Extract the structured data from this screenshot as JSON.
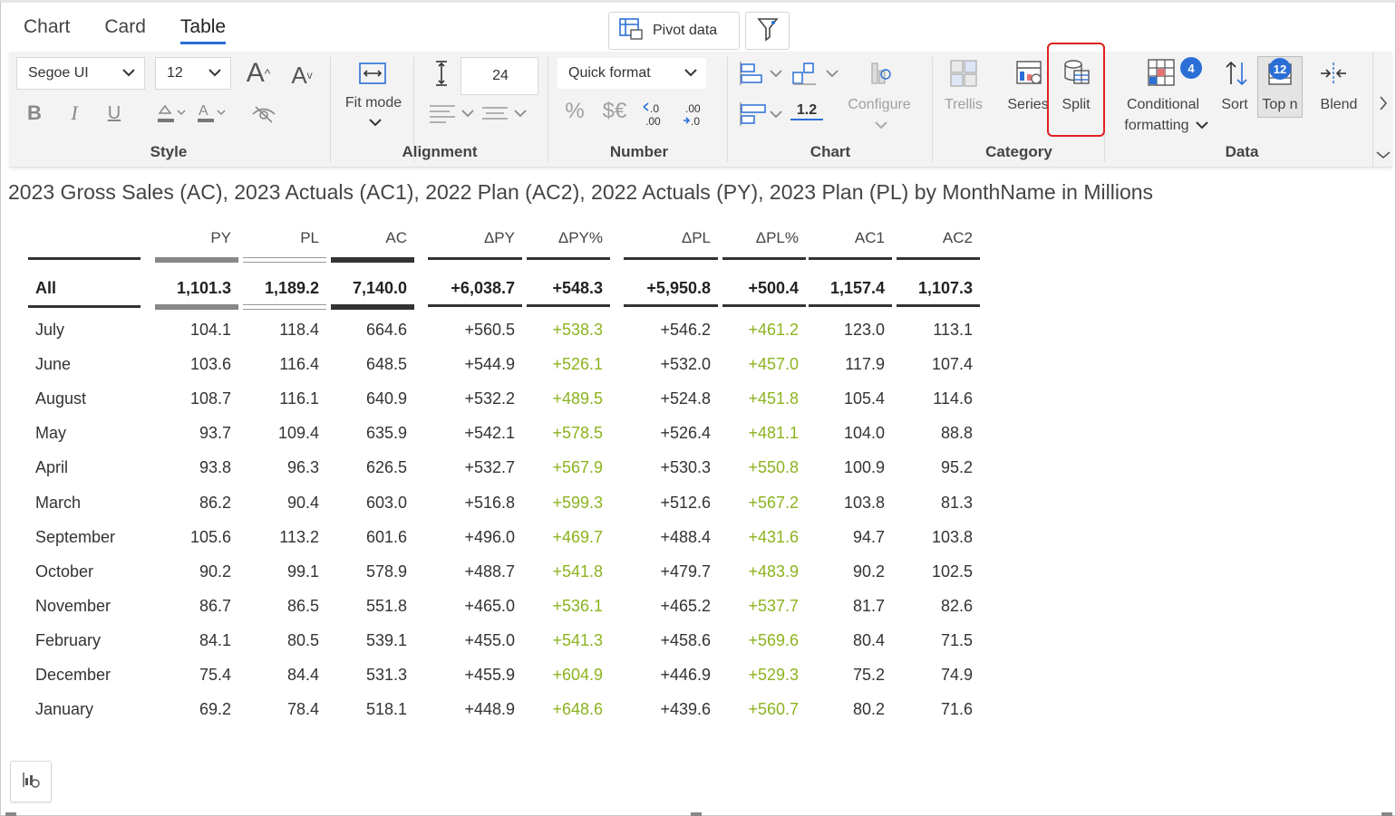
{
  "tabs": [
    {
      "label": "Chart",
      "active": false
    },
    {
      "label": "Card",
      "active": false
    },
    {
      "label": "Table",
      "active": true
    }
  ],
  "top_buttons": {
    "pivot_label": "Pivot data"
  },
  "ribbon": {
    "style": {
      "label": "Style",
      "font_family": "Segoe UI",
      "font_size": "12"
    },
    "alignment": {
      "label": "Alignment",
      "fit_mode": "Fit mode",
      "row_height": "24"
    },
    "number": {
      "label": "Number",
      "quick_format": "Quick format",
      "percent": "%",
      "currency": "$€"
    },
    "chart": {
      "label": "Chart",
      "scale_value": "1.2",
      "configure": "Configure"
    },
    "category": {
      "label": "Category",
      "trellis": "Trellis",
      "series": "Series",
      "split": "Split"
    },
    "data": {
      "label": "Data",
      "conditional_formatting_line1": "Conditional",
      "conditional_formatting_line2": "formatting",
      "conditional_formatting_count": "4",
      "sort": "Sort",
      "top_n": "Top n",
      "top_n_count": "12",
      "blend": "Blend"
    }
  },
  "table": {
    "title": "2023 Gross Sales (AC), 2023 Actuals (AC1), 2022 Plan (AC2), 2022 Actuals (PY), 2023 Plan (PL) by MonthName in Millions",
    "columns": [
      "PY",
      "PL",
      "AC",
      "ΔPY",
      "ΔPY%",
      "ΔPL",
      "ΔPL%",
      "AC1",
      "AC2"
    ],
    "total": {
      "label": "All",
      "values": [
        "1,101.3",
        "1,189.2",
        "7,140.0",
        "+6,038.7",
        "+548.3",
        "+5,950.8",
        "+500.4",
        "1,157.4",
        "1,107.3"
      ]
    },
    "rows": [
      {
        "label": "July",
        "values": [
          "104.1",
          "118.4",
          "664.6",
          "+560.5",
          "+538.3",
          "+546.2",
          "+461.2",
          "123.0",
          "113.1"
        ]
      },
      {
        "label": "June",
        "values": [
          "103.6",
          "116.4",
          "648.5",
          "+544.9",
          "+526.1",
          "+532.0",
          "+457.0",
          "117.9",
          "107.4"
        ]
      },
      {
        "label": "August",
        "values": [
          "108.7",
          "116.1",
          "640.9",
          "+532.2",
          "+489.5",
          "+524.8",
          "+451.8",
          "105.4",
          "114.6"
        ]
      },
      {
        "label": "May",
        "values": [
          "93.7",
          "109.4",
          "635.9",
          "+542.1",
          "+578.5",
          "+526.4",
          "+481.1",
          "104.0",
          "88.8"
        ]
      },
      {
        "label": "April",
        "values": [
          "93.8",
          "96.3",
          "626.5",
          "+532.7",
          "+567.9",
          "+530.3",
          "+550.8",
          "100.9",
          "95.2"
        ]
      },
      {
        "label": "March",
        "values": [
          "86.2",
          "90.4",
          "603.0",
          "+516.8",
          "+599.3",
          "+512.6",
          "+567.2",
          "103.8",
          "81.3"
        ]
      },
      {
        "label": "September",
        "values": [
          "105.6",
          "113.2",
          "601.6",
          "+496.0",
          "+469.7",
          "+488.4",
          "+431.6",
          "94.7",
          "103.8"
        ]
      },
      {
        "label": "October",
        "values": [
          "90.2",
          "99.1",
          "578.9",
          "+488.7",
          "+541.8",
          "+479.7",
          "+483.9",
          "90.2",
          "102.5"
        ]
      },
      {
        "label": "November",
        "values": [
          "86.7",
          "86.5",
          "551.8",
          "+465.0",
          "+536.1",
          "+465.2",
          "+537.7",
          "81.7",
          "82.6"
        ]
      },
      {
        "label": "February",
        "values": [
          "84.1",
          "80.5",
          "539.1",
          "+455.0",
          "+541.3",
          "+458.6",
          "+569.6",
          "80.4",
          "71.5"
        ]
      },
      {
        "label": "December",
        "values": [
          "75.4",
          "84.4",
          "531.3",
          "+455.9",
          "+604.9",
          "+446.9",
          "+529.3",
          "75.2",
          "74.9"
        ]
      },
      {
        "label": "January",
        "values": [
          "69.2",
          "78.4",
          "518.1",
          "+448.9",
          "+648.6",
          "+439.6",
          "+560.7",
          "80.2",
          "71.6"
        ]
      }
    ]
  },
  "colors": {
    "accent": "#2b6fd6",
    "positive_percent": "#8cb31f",
    "highlight": "#e02020"
  }
}
